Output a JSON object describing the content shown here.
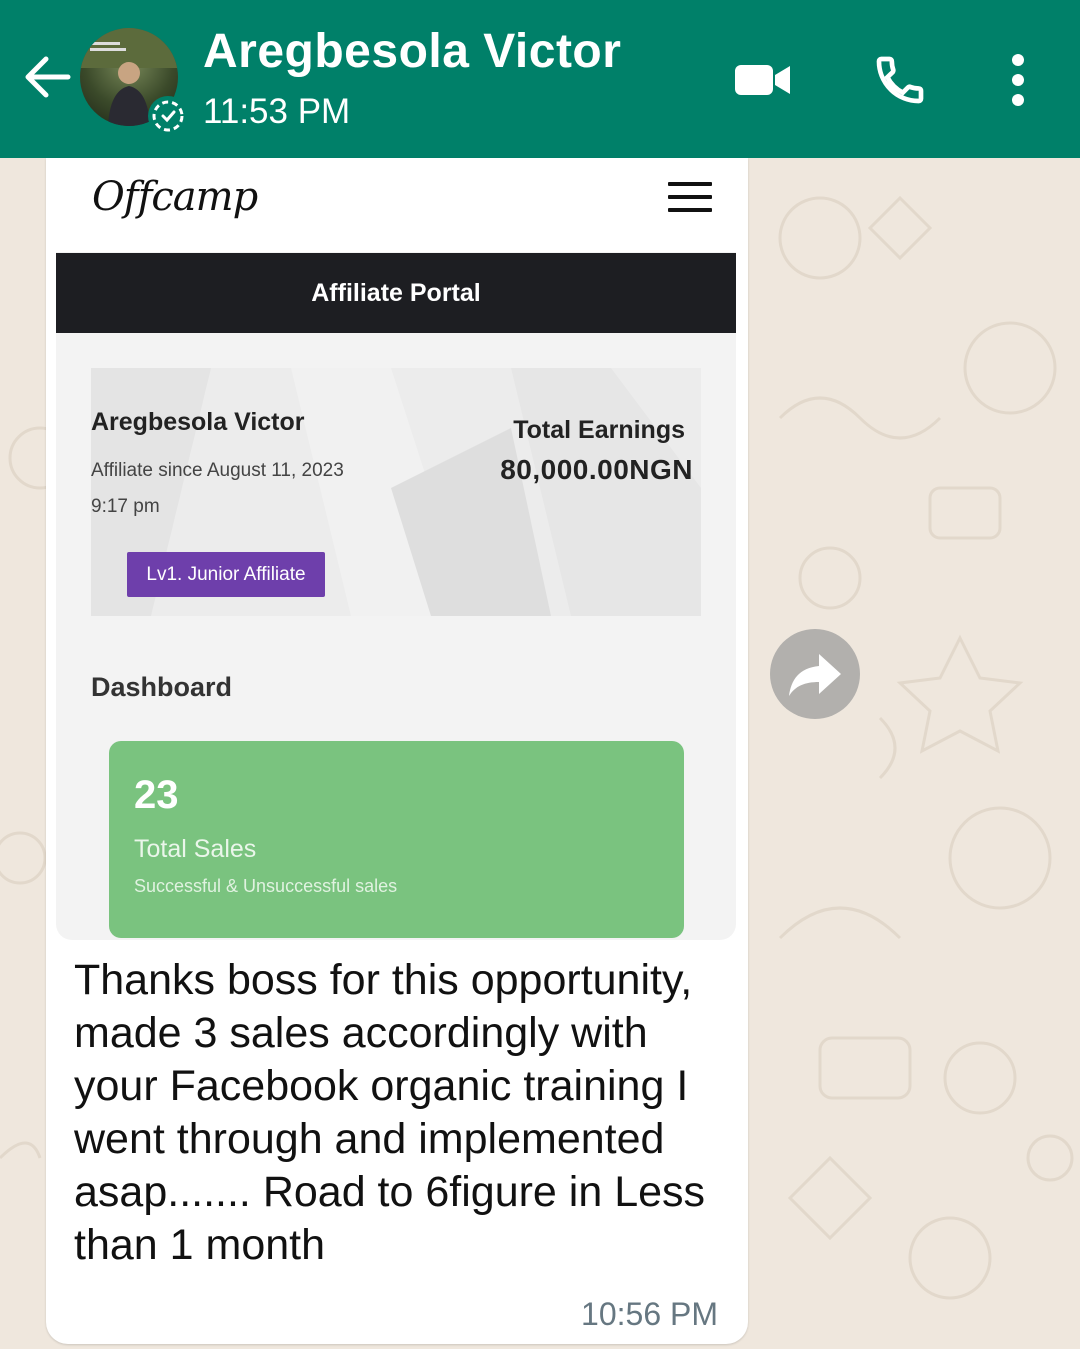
{
  "header": {
    "contact_name": "Aregbesola Victor",
    "last_seen": "11:53 PM",
    "icons": [
      "back-arrow-icon",
      "video-call-icon",
      "phone-icon",
      "more-vert-icon"
    ]
  },
  "message": {
    "image": {
      "site_logo": "Offcamp",
      "portal_title": "Affiliate Portal",
      "profile": {
        "name": "Aregbesola Victor",
        "affiliate_since": "Affiliate since August 11, 2023",
        "time": "9:17 pm",
        "level": "Lv1. Junior Affiliate",
        "earnings_label": "Total Earnings",
        "earnings_value": "80,000.00NGN"
      },
      "dashboard": {
        "title": "Dashboard",
        "stat_value": "23",
        "stat_label": "Total Sales",
        "stat_sub": "Successful & Unsuccessful sales"
      }
    },
    "text": "Thanks boss for this opportunity, made 3 sales accordingly with your Facebook organic training I went through and implemented asap....... Road to 6figure in Less than 1 month",
    "time": "10:56 PM"
  },
  "colors": {
    "header": "#008069",
    "chat_background": "#efe7dd",
    "level_badge": "#6e3fab",
    "stat_card": "#7ac37f"
  }
}
